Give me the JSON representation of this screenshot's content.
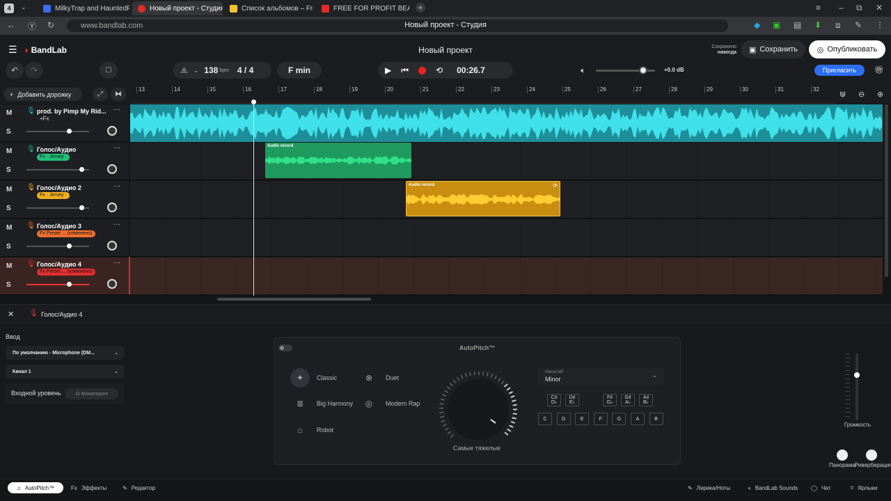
{
  "browser": {
    "tab_count": "4",
    "tabs": [
      {
        "label": "MilkyTrap and HauntedFa",
        "color": "#3b6ef5"
      },
      {
        "label": "Новый проект - Студия",
        "color": "#e02b2b"
      },
      {
        "label": "Список альбомов – Fresh",
        "color": "#f2c230"
      },
      {
        "label": "FREE FOR PROFIT BEAT -",
        "color": "#e02b2b"
      }
    ],
    "url": "www.bandlab.com",
    "page_title": "Новый проект - Студия"
  },
  "app": {
    "logo": "BandLab",
    "project": "Новый проект",
    "saved_label": "Сохранено",
    "saved_when": "никогда",
    "save": "Сохранить",
    "publish": "Опубликовать",
    "invite": "Пригласить",
    "bpm": "138",
    "bpm_unit": "bpm",
    "meter": "4 / 4",
    "key": "F min",
    "time": "00:26.7",
    "volume_db": "+0.0 dB",
    "volume_level": 0.8,
    "add_track": "Добавить дорожку"
  },
  "ruler": [
    "13",
    "14",
    "15",
    "16",
    "17",
    "18",
    "19",
    "20",
    "21",
    "22",
    "23",
    "24",
    "25",
    "26",
    "27",
    "28",
    "29",
    "30",
    "31",
    "32"
  ],
  "tracks": [
    {
      "name": "prod. by Pimp My Rid...",
      "fx": "+Fx",
      "color": "#2ab8c4",
      "mute": "M",
      "solo": "S",
      "vol": 0.68
    },
    {
      "name": "Голос/Аудио",
      "fx": "Fx · Jersey ·",
      "color": "#20c07a",
      "mute": "M",
      "solo": "S",
      "vol": 0.88
    },
    {
      "name": "Голос/Аудио 2",
      "fx": "Fx · Jersey ·",
      "color": "#f0b020",
      "mute": "M",
      "solo": "S",
      "vol": 0.88
    },
    {
      "name": "Голос/Аудио 3",
      "fx": "Fx Preset ... (изменено)",
      "color": "#f07030",
      "mute": "M",
      "solo": "S",
      "vol": 0.68
    },
    {
      "name": "Голос/Аудио 4",
      "fx": "Fx Preset ... (изменено)",
      "color": "#e03030",
      "mute": "M",
      "solo": "S",
      "vol": 0.68
    }
  ],
  "clips": {
    "clip1": "Audio record",
    "clip2": "Audio record"
  },
  "panel": {
    "track": "Голос/Аудио 4",
    "input_label": "Ввод",
    "device": "По умолчанию - Microphone (DM...",
    "channel": "Канал 1",
    "input_level": "Входной уровень",
    "monitoring": "Мониторинг",
    "autopitch": "AutoPitch™",
    "presets": [
      "Classic",
      "Duet",
      "Big Harmony",
      "Modern Rap",
      "Robot"
    ],
    "dial_label": "Самые тяжелые",
    "scale_label": "Масштаб",
    "scale": "Minor",
    "sharps": [
      "C♯ D♭",
      "D♯ E♭",
      "F♯ G♭",
      "G♯ A♭",
      "A♯ B♭"
    ],
    "notes": [
      "C",
      "D",
      "E",
      "F",
      "G",
      "A",
      "B"
    ],
    "volume": "Громкость",
    "pan": "Панорама",
    "reverb": "Реверберация"
  },
  "bottom": {
    "autopitch": "AutoPitch™",
    "effects": "Эффекты",
    "editor": "Редактор",
    "lyrics": "Лирика/Ноты",
    "sounds": "BandLab Sounds",
    "chat": "Чат",
    "labels": "Ярлыки"
  }
}
